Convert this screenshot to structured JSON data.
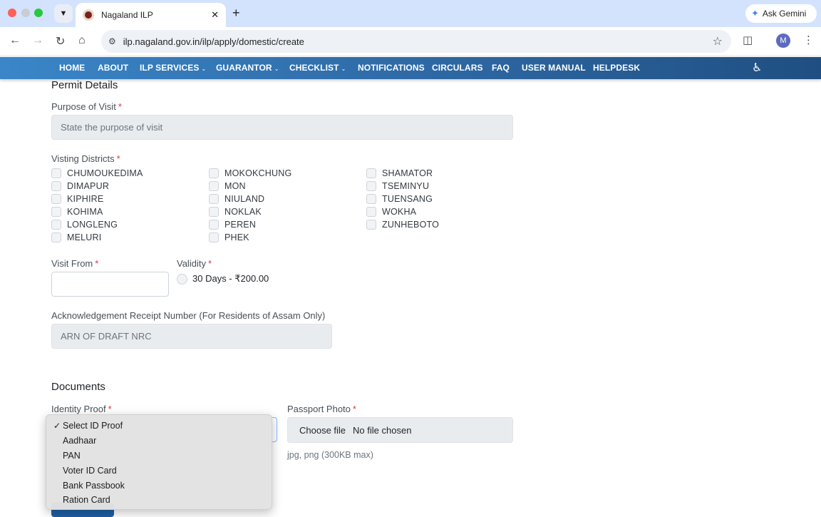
{
  "browser": {
    "tab_title": "Nagaland ILP",
    "url": "ilp.nagaland.gov.in/ilp/apply/domestic/create",
    "gemini_label": "Ask Gemini",
    "avatar_initial": "M"
  },
  "nav": {
    "items": [
      {
        "label": "HOME",
        "caret": false
      },
      {
        "label": "ABOUT",
        "caret": false
      },
      {
        "label": "ILP SERVICES",
        "caret": true
      },
      {
        "label": "GUARANTOR",
        "caret": true
      },
      {
        "label": "CHECKLIST",
        "caret": true
      },
      {
        "label": "NOTIFICATIONS",
        "caret": false
      },
      {
        "label": "CIRCULARS",
        "caret": false
      },
      {
        "label": "FAQ",
        "caret": false
      },
      {
        "label": "USER MANUAL",
        "caret": false
      },
      {
        "label": "HELPDESK",
        "caret": false
      }
    ]
  },
  "permit": {
    "heading": "Permit Details",
    "purpose_label": "Purpose of Visit",
    "purpose_placeholder": "State the purpose of visit",
    "districts_label": "Visting Districts",
    "districts": [
      [
        "CHUMOUKEDIMA",
        "DIMAPUR",
        "KIPHIRE",
        "KOHIMA",
        "LONGLENG",
        "MELURI"
      ],
      [
        "MOKOKCHUNG",
        "MON",
        "NIULAND",
        "NOKLAK",
        "PEREN",
        "PHEK"
      ],
      [
        "SHAMATOR",
        "TSEMINYU",
        "TUENSANG",
        "WOKHA",
        "ZUNHEBOTO"
      ]
    ],
    "visit_from_label": "Visit From",
    "visit_from_value": "",
    "validity_label": "Validity",
    "validity_option": "30 Days - ₹200.00",
    "ack_label": "Acknowledgement Receipt Number (For Residents of Assam Only)",
    "ack_placeholder": "ARN OF DRAFT NRC"
  },
  "documents": {
    "heading": "Documents",
    "identity_label": "Identity Proof",
    "identity_options": [
      "Select ID Proof",
      "Aadhaar",
      "PAN",
      "Voter ID Card",
      "Bank Passbook",
      "Ration Card"
    ],
    "identity_selected_index": 0,
    "photo_label": "Passport Photo",
    "choose_file_label": "Choose file",
    "file_status": "No file chosen",
    "photo_hint": "jpg, png (300KB max)"
  },
  "required_marker": "*"
}
